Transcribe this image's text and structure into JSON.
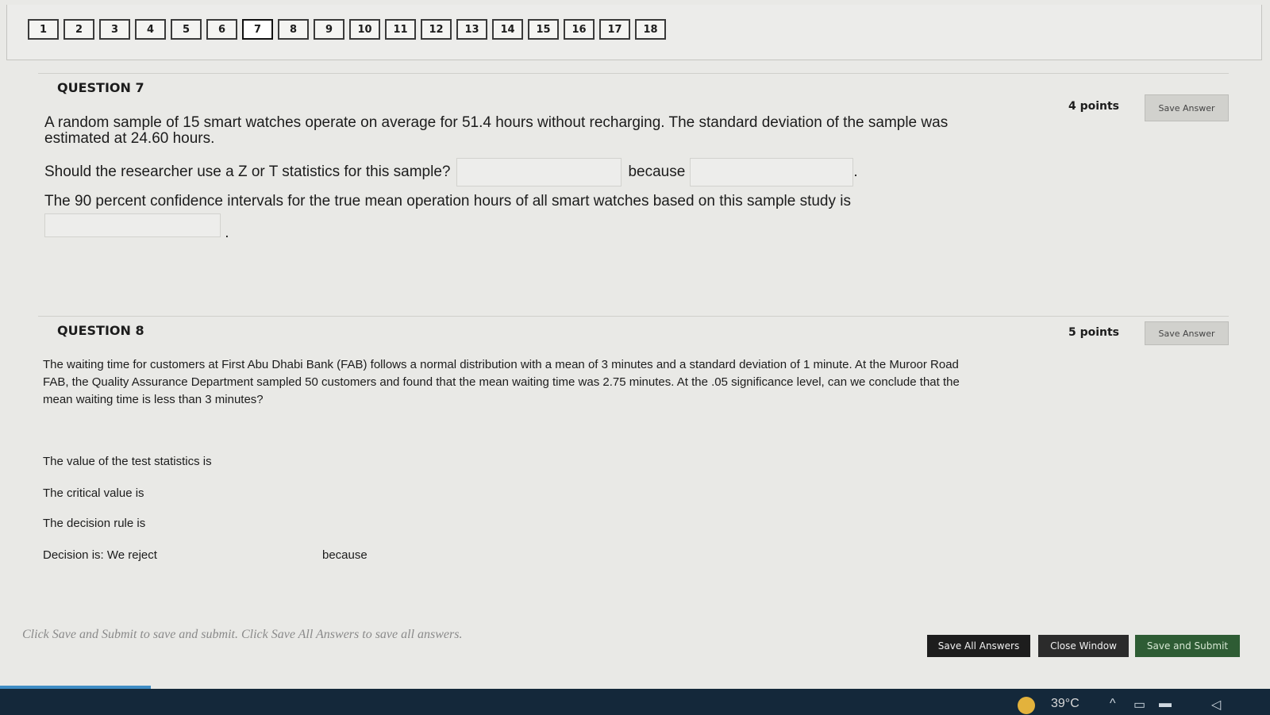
{
  "nav": {
    "questions": [
      "1",
      "2",
      "3",
      "4",
      "5",
      "6",
      "7",
      "8",
      "9",
      "10",
      "11",
      "12",
      "13",
      "14",
      "15",
      "16",
      "17",
      "18"
    ]
  },
  "q7": {
    "title": "QUESTION 7",
    "points": "4 points",
    "save_label": "Save Answer",
    "stem": "A random sample of 15 smart watches operate on average for 51.4 hours without recharging. The standard deviation of the sample was estimated at 24.60 hours.",
    "prompt1": "Should the researcher use a Z or T statistics for this sample?",
    "because": "because",
    "period": ".",
    "prompt2": "The 90 percent confidence intervals for the true mean operation hours of all smart watches based on this sample study is",
    "period2": "."
  },
  "q8": {
    "title": "QUESTION 8",
    "points": "5 points",
    "save_label": "Save Answer",
    "stem": "The waiting time for customers at First Abu Dhabi Bank (FAB) follows a normal distribution with a mean of 3 minutes and a standard deviation of 1 minute. At the Muroor Road FAB, the Quality Assurance Department sampled 50 customers and found that the mean waiting time was 2.75 minutes. At the .05 significance level, can we conclude that the mean waiting time is less than 3 minutes?",
    "line1": "The value of the test statistics is",
    "line2": "The critical value is",
    "line3": "The decision rule is",
    "line4": "Decision is: We reject",
    "because": "because"
  },
  "footer": {
    "instructions": "Click Save and Submit to save and submit. Click Save All Answers to save all answers.",
    "save_all": "Save All Answers",
    "close_window": "Close Window",
    "save_submit": "Save and Submit"
  },
  "taskbar": {
    "temperature": "39°C"
  }
}
